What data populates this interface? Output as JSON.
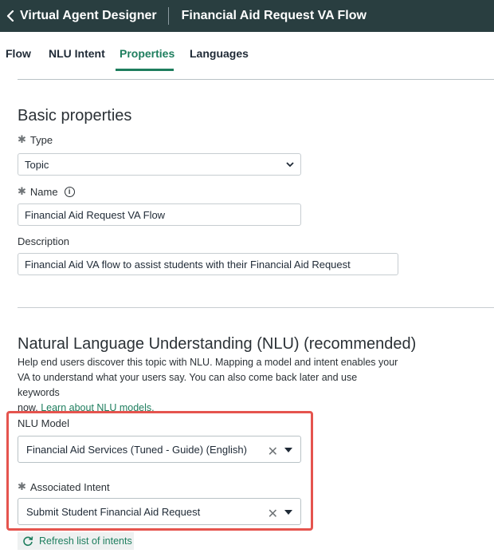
{
  "header": {
    "back_label": "Virtual Agent Designer",
    "flow_title": "Financial Aid Request VA Flow"
  },
  "tabs": [
    {
      "label": "Flow"
    },
    {
      "label": "NLU Intent"
    },
    {
      "label": "Properties",
      "active": true
    },
    {
      "label": "Languages"
    }
  ],
  "basic": {
    "heading": "Basic properties",
    "type_label": "Type",
    "type_value": "Topic",
    "name_label": "Name",
    "name_value": "Financial Aid Request VA Flow",
    "description_label": "Description",
    "description_value": "Financial Aid VA flow to assist students with their Financial Aid Request"
  },
  "nlu": {
    "heading": "Natural Language Understanding (NLU) (recommended)",
    "help_line1": "Help end users discover this topic with NLU. Mapping a model and intent enables your",
    "help_line2": "VA to understand what your users say. You can also come back later and use keywords",
    "help_line3_prefix": "now. ",
    "help_link": "Learn about NLU models.",
    "model_label": "NLU Model",
    "model_value": "Financial Aid Services (Tuned - Guide) (English)",
    "intent_label": "Associated Intent",
    "intent_value": "Submit Student Financial Aid Request",
    "refresh_label": "Refresh list of intents"
  },
  "colors": {
    "header_bg": "#293e40",
    "accent": "#1e7e5e",
    "highlight": "#e5544e"
  }
}
